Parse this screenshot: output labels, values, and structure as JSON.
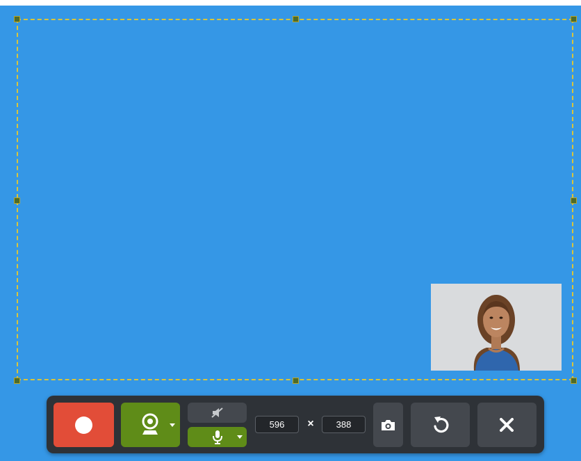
{
  "capture": {
    "width_value": "596",
    "height_value": "388",
    "separator": "×"
  },
  "toolbar": {
    "record_icon": "record-icon",
    "webcam_icon": "webcam-icon",
    "audio_off_icon": "speaker-muted-icon",
    "mic_icon": "microphone-icon",
    "snapshot_icon": "camera-icon",
    "restart_icon": "restart-icon",
    "close_icon": "close-icon"
  },
  "webcam_preview": {
    "subject": "person-photo"
  },
  "colors": {
    "canvas": "#3597e6",
    "record": "#e24d38",
    "active": "#5f8c18",
    "toolbar": "#2e3237",
    "button": "#44484e",
    "region_border": "#d9c53a"
  }
}
